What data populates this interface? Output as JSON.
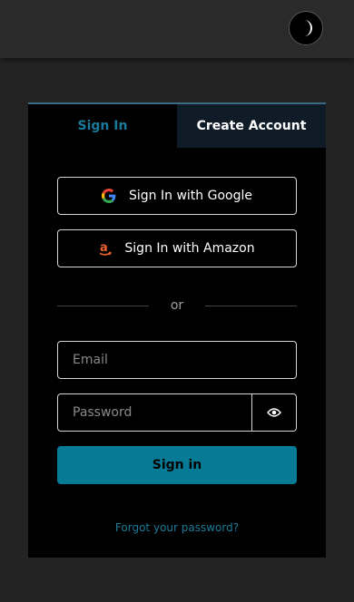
{
  "header": {
    "theme_toggle_icon": "moon-icon"
  },
  "tabs": [
    {
      "label": "Sign In",
      "active": true
    },
    {
      "label": "Create Account",
      "active": false
    }
  ],
  "social": {
    "google_label": "Sign In with Google",
    "google_icon": "google-icon",
    "amazon_label": "Sign In with Amazon",
    "amazon_icon": "amazon-icon"
  },
  "divider_text": "or",
  "form": {
    "email_placeholder": "Email",
    "email_value": "",
    "password_placeholder": "Password",
    "password_value": "",
    "show_password_icon": "eye-icon",
    "submit_label": "Sign in",
    "forgot_label": "Forgot your password?"
  },
  "colors": {
    "accent": "#077a96",
    "link": "#1b7a99",
    "background": "#232323",
    "card": "#000000"
  }
}
